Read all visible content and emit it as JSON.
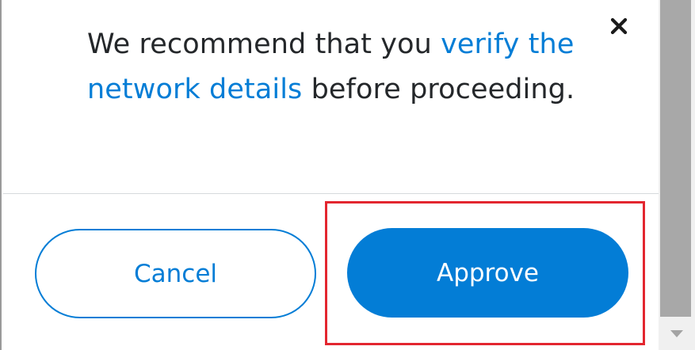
{
  "dialog": {
    "message_before": "We recommend that you ",
    "message_link": "verify the network details",
    "message_after": " before proceeding.",
    "close_icon": "close-icon"
  },
  "actions": {
    "cancel_label": "Cancel",
    "approve_label": "Approve"
  },
  "colors": {
    "accent": "#037dd6",
    "text": "#24272a",
    "highlight": "#e3262f"
  }
}
